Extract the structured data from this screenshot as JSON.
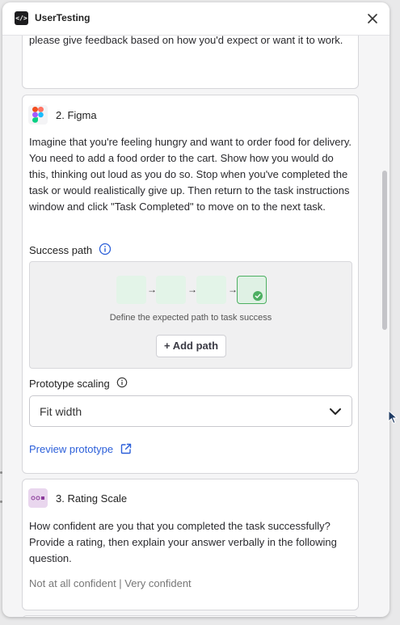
{
  "window": {
    "app_title": "UserTesting",
    "app_logo_glyph": "</>",
    "close_icon": "close-icon"
  },
  "card1": {
    "text": "please give feedback based on how you'd expect or want it to work."
  },
  "card2": {
    "title": "2. Figma",
    "icon": "figma-icon",
    "body": "Imagine that you're feeling hungry and want to order food for delivery. You need to add a food order to the cart. Show how you would do this, thinking out loud as you do so. Stop when you've completed the task or would realistically give up. Then return to the task instructions window and click \"Task Completed\" to move on to the next task.",
    "success_path_label": "Success path",
    "success_hint": "Define the expected path to task success",
    "add_path_label": "+ Add path",
    "scaling_label": "Prototype scaling",
    "scaling_value": "Fit width",
    "preview_label": "Preview prototype"
  },
  "card3": {
    "title": "3. Rating Scale",
    "icon": "rating-scale-icon",
    "body": "How confident are you that you completed the task successfully? Provide a rating, then explain your answer verbally in the following question.",
    "scale_text": "Not at all confident | Very confident"
  },
  "colors": {
    "link": "#2b5fd9",
    "success_green": "#4caf61",
    "step_fill": "#e3f4e8",
    "rating_icon_bg": "#e9d6ee"
  }
}
